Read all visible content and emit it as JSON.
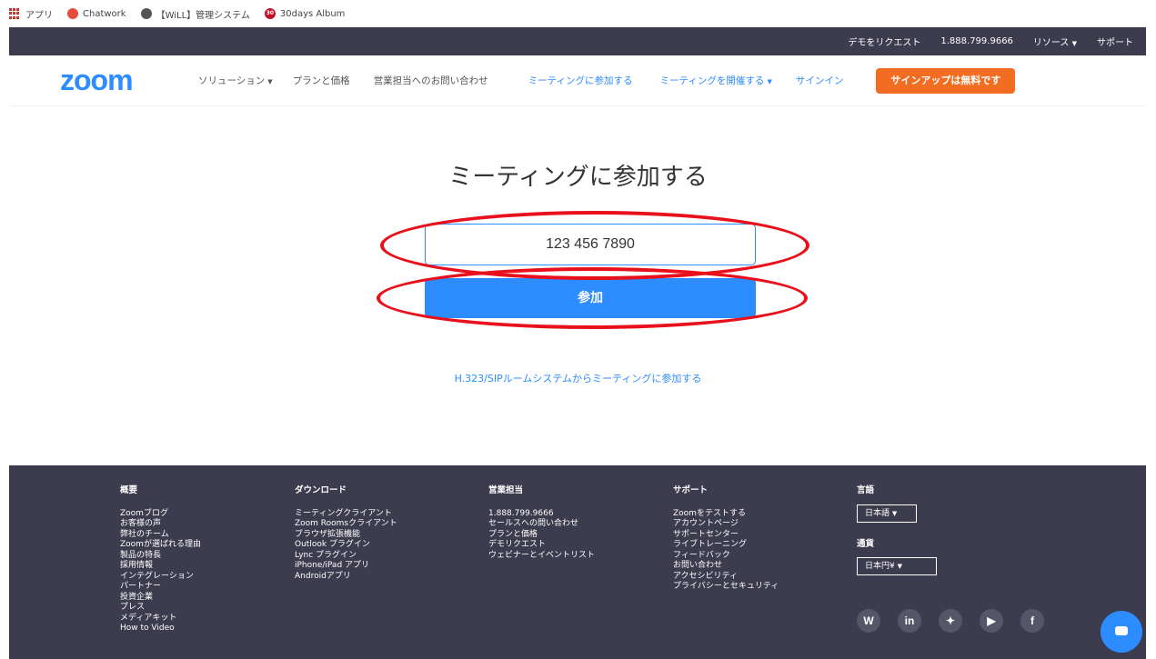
{
  "bookmarks": [
    {
      "icon": "apps-grid-icon",
      "label": "アプリ"
    },
    {
      "icon": "chatwork-icon",
      "label": "Chatwork"
    },
    {
      "icon": "will-icon",
      "label": "【WiLL】管理システム"
    },
    {
      "icon": "30days-icon",
      "label": "30days Album"
    }
  ],
  "topbar": {
    "demo": "デモをリクエスト",
    "phone": "1.888.799.9666",
    "resources": "リソース",
    "support": "サポート"
  },
  "nav": {
    "logo": "zoom",
    "solutions": "ソリューション",
    "plans": "プランと価格",
    "contact_sales": "営業担当へのお問い合わせ",
    "join": "ミーティングに参加する",
    "host": "ミーティングを開催する",
    "signin": "サインイン",
    "signup": "サインアップは無料です"
  },
  "main": {
    "title": "ミーティングに参加する",
    "meeting_id_value": "123 456 7890",
    "join_button": "参加",
    "h323_link": "H.323/SIPルームシステムからミーティングに参加する"
  },
  "footer": {
    "col1": {
      "heading": "概要",
      "links": [
        "Zoomブログ",
        "お客様の声",
        "弊社のチーム",
        "Zoomが選ばれる理由",
        "製品の特長",
        "採用情報",
        "インテグレーション",
        "パートナー",
        "投資企業",
        "プレス",
        "メディアキット",
        "How to Video"
      ]
    },
    "col2": {
      "heading": "ダウンロード",
      "links": [
        "ミーティングクライアント",
        "Zoom Roomsクライアント",
        "ブラウザ拡張機能",
        "Outlook プラグイン",
        "Lync プラグイン",
        "iPhone/iPad アプリ",
        "Androidアプリ"
      ]
    },
    "col3": {
      "heading": "営業担当",
      "links": [
        "1.888.799.9666",
        "セールスへの問い合わせ",
        "プランと価格",
        "デモリクエスト",
        "ウェビナーとイベントリスト"
      ]
    },
    "col4": {
      "heading": "サポート",
      "links": [
        "Zoomをテストする",
        "アカウントページ",
        "サポートセンター",
        "ライブトレーニング",
        "フィードバック",
        "お問い合わせ",
        "アクセシビリティ",
        "プライバシーとセキュリティ"
      ]
    },
    "language": {
      "heading": "言語",
      "value": "日本語"
    },
    "currency": {
      "heading": "通貨",
      "value": "日本円¥"
    },
    "social": [
      "wordpress-icon",
      "linkedin-icon",
      "twitter-icon",
      "youtube-icon",
      "facebook-icon"
    ]
  },
  "colors": {
    "brand": "#2d8cff",
    "signup": "#f26d21",
    "dark": "#3c3c4e",
    "annotation": "#e8101a"
  }
}
